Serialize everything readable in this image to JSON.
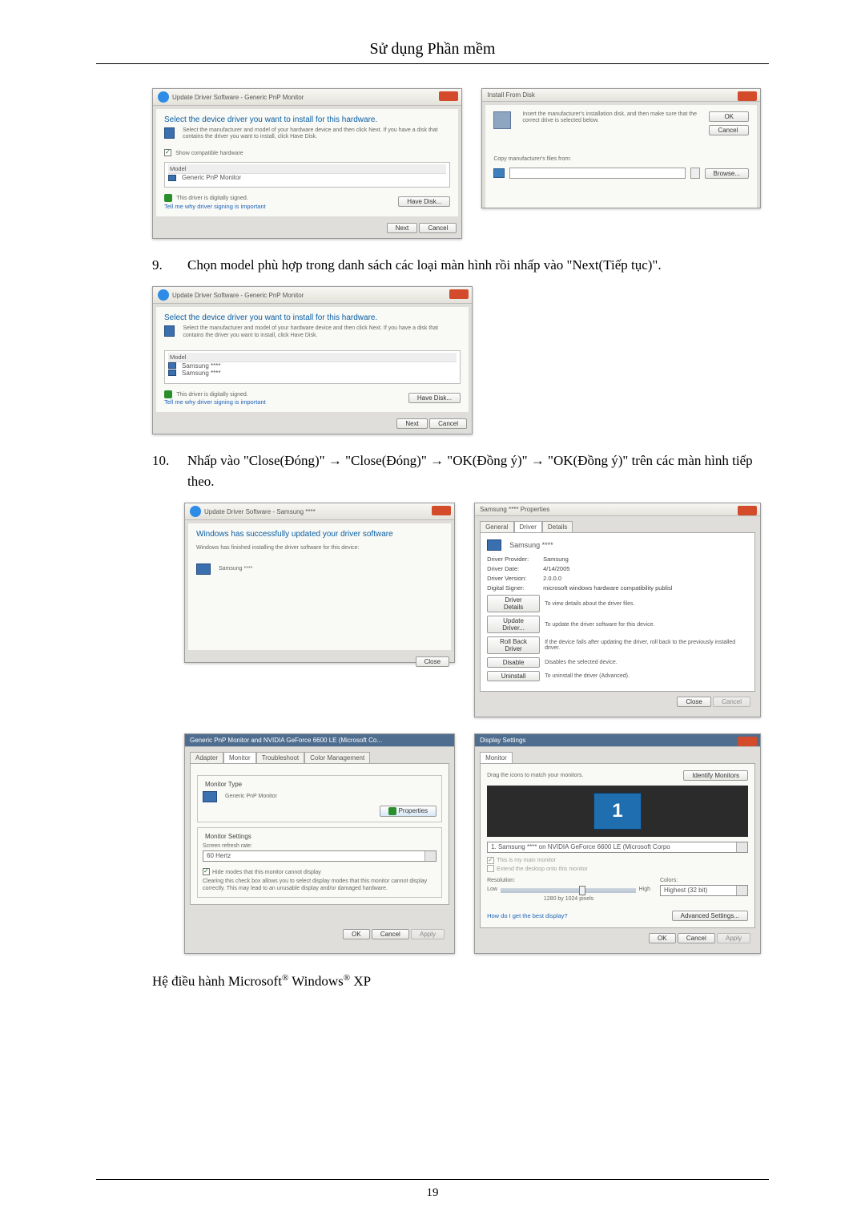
{
  "header": {
    "title": "Sử dụng Phần mềm"
  },
  "shotA": {
    "titlebar": "Update Driver Software - Generic PnP Monitor",
    "heading": "Select the device driver you want to install for this hardware.",
    "desc": "Select the manufacturer and model of your hardware device and then click Next. If you have a disk that contains the driver you want to install, click Have Disk.",
    "show_compatible": "Show compatible hardware",
    "model_hdr": "Model",
    "model_item": "Generic PnP Monitor",
    "signed": "This driver is digitally signed.",
    "why_link": "Tell me why driver signing is important",
    "have_disk": "Have Disk...",
    "next": "Next",
    "cancel": "Cancel"
  },
  "shotB": {
    "title": "Install From Disk",
    "desc": "Insert the manufacturer's installation disk, and then make sure that the correct drive is selected below.",
    "ok": "OK",
    "cancel": "Cancel",
    "copy_label": "Copy manufacturer's files from:",
    "browse": "Browse..."
  },
  "step9": {
    "num": "9.",
    "text": "Chọn model phù hợp trong danh sách các loại màn hình rồi nhấp vào \"Next(Tiếp tục)\"."
  },
  "shotC": {
    "titlebar": "Update Driver Software - Generic PnP Monitor",
    "heading": "Select the device driver you want to install for this hardware.",
    "desc": "Select the manufacturer and model of your hardware device and then click Next. If you have a disk that contains the driver you want to install, click Have Disk.",
    "model_hdr": "Model",
    "item1": "Samsung ****",
    "item2": "Samsung ****",
    "signed": "This driver is digitally signed.",
    "why_link": "Tell me why driver signing is important",
    "have_disk": "Have Disk...",
    "next": "Next",
    "cancel": "Cancel"
  },
  "step10": {
    "num": "10.",
    "text": "Nhấp vào \"Close(Đóng)\" → \"Close(Đóng)\" → \"OK(Đồng ý)\" → \"OK(Đồng ý)\" trên các màn hình tiếp theo."
  },
  "shotD": {
    "titlebar": "Update Driver Software - Samsung ****",
    "heading": "Windows has successfully updated your driver software",
    "sub": "Windows has finished installing the driver software for this device:",
    "device": "Samsung ****",
    "close": "Close"
  },
  "shotE": {
    "title": "Samsung **** Properties",
    "tab_general": "General",
    "tab_driver": "Driver",
    "tab_details": "Details",
    "device": "Samsung ****",
    "provider_l": "Driver Provider:",
    "provider_v": "Samsung",
    "date_l": "Driver Date:",
    "date_v": "4/14/2005",
    "version_l": "Driver Version:",
    "version_v": "2.0.0.0",
    "signer_l": "Digital Signer:",
    "signer_v": "microsoft windows hardware compatibility publisl",
    "btn_details": "Driver Details",
    "btn_details_d": "To view details about the driver files.",
    "btn_update": "Update Driver...",
    "btn_update_d": "To update the driver software for this device.",
    "btn_rollback": "Roll Back Driver",
    "btn_rollback_d": "If the device fails after updating the driver, roll back to the previously installed driver.",
    "btn_disable": "Disable",
    "btn_disable_d": "Disables the selected device.",
    "btn_uninstall": "Uninstall",
    "btn_uninstall_d": "To uninstall the driver (Advanced).",
    "close": "Close",
    "cancel": "Cancel"
  },
  "shotF": {
    "title": "Generic PnP Monitor and NVIDIA GeForce 6600 LE (Microsoft Co...",
    "tab_adapter": "Adapter",
    "tab_monitor": "Monitor",
    "tab_trouble": "Troubleshoot",
    "tab_color": "Color Management",
    "grp_type": "Monitor Type",
    "type_val": "Generic PnP Monitor",
    "properties": "Properties",
    "grp_settings": "Monitor Settings",
    "refresh_l": "Screen refresh rate:",
    "refresh_v": "60 Hertz",
    "hide_modes": "Hide modes that this monitor cannot display",
    "hide_desc": "Clearing this check box allows you to select display modes that this monitor cannot display correctly. This may lead to an unusable display and/or damaged hardware.",
    "ok": "OK",
    "cancel": "Cancel",
    "apply": "Apply"
  },
  "shotG": {
    "title": "Display Settings",
    "tab_monitor": "Monitor",
    "drag": "Drag the icons to match your monitors.",
    "identify": "Identify Monitors",
    "monitor_num": "1",
    "combo": "1. Samsung **** on NVIDIA GeForce 6600 LE (Microsoft Corpo",
    "main": "This is my main monitor",
    "extend": "Extend the desktop onto this monitor",
    "res_l": "Resolution:",
    "low": "Low",
    "high": "High",
    "res_val": "1280 by 1024 pixels",
    "col_l": "Colors:",
    "col_v": "Highest (32 bit)",
    "best_link": "How do I get the best display?",
    "advanced": "Advanced Settings...",
    "ok": "OK",
    "cancel": "Cancel",
    "apply": "Apply"
  },
  "footer_text": {
    "prefix": "Hệ điều hành Microsoft",
    "reg1": "®",
    "mid": " Windows",
    "reg2": "®",
    "suffix": " XP"
  },
  "page_number": "19"
}
